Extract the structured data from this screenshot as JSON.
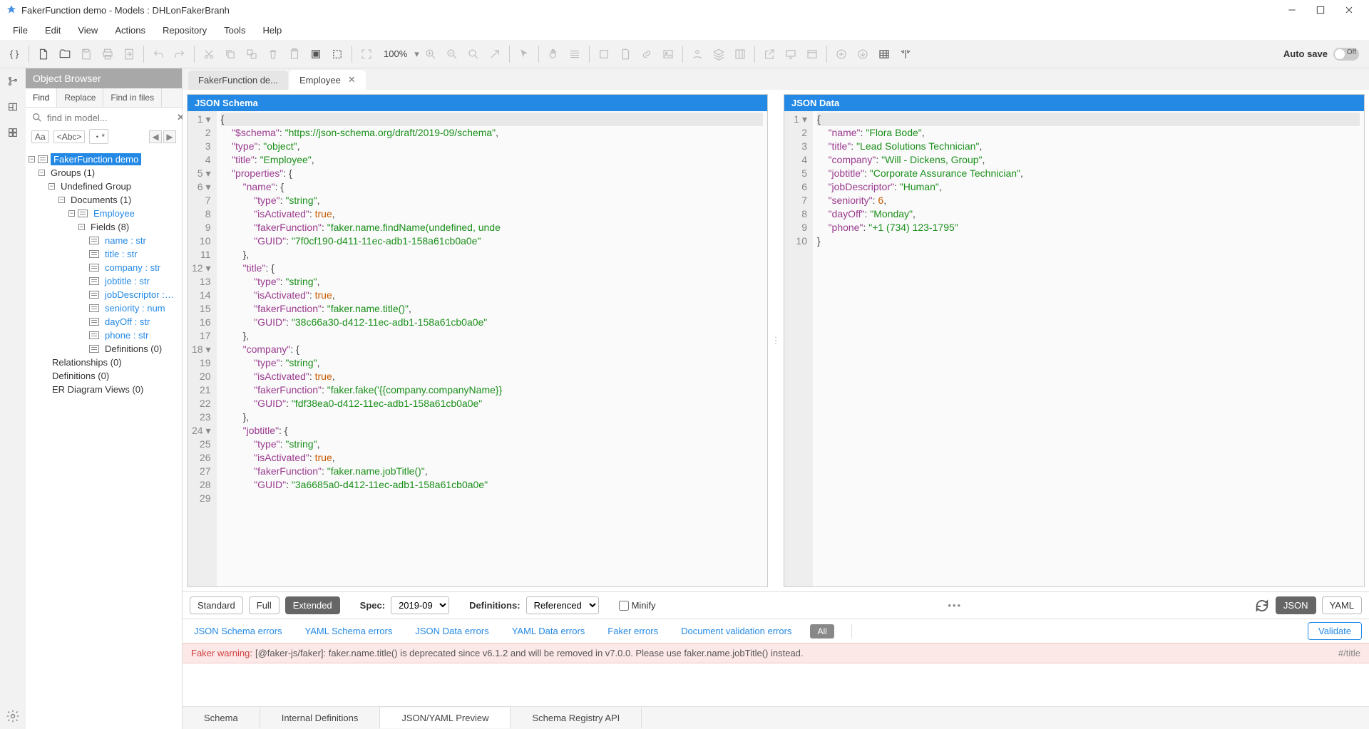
{
  "window": {
    "title": "FakerFunction demo - Models : DHLonFakerBranh"
  },
  "menu": [
    "File",
    "Edit",
    "View",
    "Actions",
    "Repository",
    "Tools",
    "Help"
  ],
  "toolbar": {
    "zoom": "100%",
    "autosave_label": "Auto save",
    "autosave_state": "Off"
  },
  "browser": {
    "title": "Object Browser",
    "tabs": [
      "Find",
      "Replace",
      "Find in files"
    ],
    "search_placeholder": "find in model...",
    "match_opts": [
      "Aa",
      "<Abc>",
      "・*"
    ]
  },
  "tree": {
    "root": "FakerFunction demo",
    "groups": "Groups (1)",
    "undef": "Undefined Group",
    "docs": "Documents (1)",
    "employee": "Employee",
    "fields_lbl": "Fields (8)",
    "fields": [
      "name : str",
      "title : str",
      "company : str",
      "jobtitle : str",
      "jobDescriptor : str",
      "seniority : num",
      "dayOff : str",
      "phone : str"
    ],
    "defs": "Definitions (0)",
    "rels": "Relationships (0)",
    "defs2": "Definitions (0)",
    "er": "ER Diagram Views (0)"
  },
  "tabs": [
    {
      "label": "FakerFunction de...",
      "closable": false
    },
    {
      "label": "Employee",
      "closable": true
    }
  ],
  "panes": {
    "left": "JSON Schema",
    "right": "JSON Data"
  },
  "schema_gutter": [
    "1 ▾",
    "2",
    "3",
    "4",
    "5 ▾",
    "6 ▾",
    "7",
    "8",
    "9",
    "10",
    "11",
    "12 ▾",
    "13",
    "14",
    "15",
    "16",
    "17",
    "18 ▾",
    "19",
    "20",
    "21",
    "22",
    "23",
    "24 ▾",
    "25",
    "26",
    "27",
    "28",
    "29"
  ],
  "schema_lines": [
    [
      [
        "p",
        "{"
      ]
    ],
    [
      [
        "p",
        "    "
      ],
      [
        "k",
        "\"$schema\""
      ],
      [
        "p",
        ": "
      ],
      [
        "s",
        "\"https://json-schema.org/draft/2019-09/schema\""
      ],
      [
        "p",
        ","
      ]
    ],
    [
      [
        "p",
        "    "
      ],
      [
        "k",
        "\"type\""
      ],
      [
        "p",
        ": "
      ],
      [
        "s",
        "\"object\""
      ],
      [
        "p",
        ","
      ]
    ],
    [
      [
        "p",
        "    "
      ],
      [
        "k",
        "\"title\""
      ],
      [
        "p",
        ": "
      ],
      [
        "s",
        "\"Employee\""
      ],
      [
        "p",
        ","
      ]
    ],
    [
      [
        "p",
        "    "
      ],
      [
        "k",
        "\"properties\""
      ],
      [
        "p",
        ": {"
      ]
    ],
    [
      [
        "p",
        "        "
      ],
      [
        "k",
        "\"name\""
      ],
      [
        "p",
        ": {"
      ]
    ],
    [
      [
        "p",
        "            "
      ],
      [
        "k",
        "\"type\""
      ],
      [
        "p",
        ": "
      ],
      [
        "s",
        "\"string\""
      ],
      [
        "p",
        ","
      ]
    ],
    [
      [
        "p",
        "            "
      ],
      [
        "k",
        "\"isActivated\""
      ],
      [
        "p",
        ": "
      ],
      [
        "b",
        "true"
      ],
      [
        "p",
        ","
      ]
    ],
    [
      [
        "p",
        "            "
      ],
      [
        "k",
        "\"fakerFunction\""
      ],
      [
        "p",
        ": "
      ],
      [
        "s",
        "\"faker.name.findName(undefined, unde"
      ]
    ],
    [
      [
        "p",
        "            "
      ],
      [
        "k",
        "\"GUID\""
      ],
      [
        "p",
        ": "
      ],
      [
        "s",
        "\"7f0cf190-d411-11ec-adb1-158a61cb0a0e\""
      ]
    ],
    [
      [
        "p",
        "        },"
      ]
    ],
    [
      [
        "p",
        "        "
      ],
      [
        "k",
        "\"title\""
      ],
      [
        "p",
        ": {"
      ]
    ],
    [
      [
        "p",
        "            "
      ],
      [
        "k",
        "\"type\""
      ],
      [
        "p",
        ": "
      ],
      [
        "s",
        "\"string\""
      ],
      [
        "p",
        ","
      ]
    ],
    [
      [
        "p",
        "            "
      ],
      [
        "k",
        "\"isActivated\""
      ],
      [
        "p",
        ": "
      ],
      [
        "b",
        "true"
      ],
      [
        "p",
        ","
      ]
    ],
    [
      [
        "p",
        "            "
      ],
      [
        "k",
        "\"fakerFunction\""
      ],
      [
        "p",
        ": "
      ],
      [
        "s",
        "\"faker.name.title()\""
      ],
      [
        "p",
        ","
      ]
    ],
    [
      [
        "p",
        "            "
      ],
      [
        "k",
        "\"GUID\""
      ],
      [
        "p",
        ": "
      ],
      [
        "s",
        "\"38c66a30-d412-11ec-adb1-158a61cb0a0e\""
      ]
    ],
    [
      [
        "p",
        "        },"
      ]
    ],
    [
      [
        "p",
        "        "
      ],
      [
        "k",
        "\"company\""
      ],
      [
        "p",
        ": {"
      ]
    ],
    [
      [
        "p",
        "            "
      ],
      [
        "k",
        "\"type\""
      ],
      [
        "p",
        ": "
      ],
      [
        "s",
        "\"string\""
      ],
      [
        "p",
        ","
      ]
    ],
    [
      [
        "p",
        "            "
      ],
      [
        "k",
        "\"isActivated\""
      ],
      [
        "p",
        ": "
      ],
      [
        "b",
        "true"
      ],
      [
        "p",
        ","
      ]
    ],
    [
      [
        "p",
        "            "
      ],
      [
        "k",
        "\"fakerFunction\""
      ],
      [
        "p",
        ": "
      ],
      [
        "s",
        "\"faker.fake('{{company.companyName}}"
      ]
    ],
    [
      [
        "p",
        "            "
      ],
      [
        "k",
        "\"GUID\""
      ],
      [
        "p",
        ": "
      ],
      [
        "s",
        "\"fdf38ea0-d412-11ec-adb1-158a61cb0a0e\""
      ]
    ],
    [
      [
        "p",
        "        },"
      ]
    ],
    [
      [
        "p",
        "        "
      ],
      [
        "k",
        "\"jobtitle\""
      ],
      [
        "p",
        ": {"
      ]
    ],
    [
      [
        "p",
        "            "
      ],
      [
        "k",
        "\"type\""
      ],
      [
        "p",
        ": "
      ],
      [
        "s",
        "\"string\""
      ],
      [
        "p",
        ","
      ]
    ],
    [
      [
        "p",
        "            "
      ],
      [
        "k",
        "\"isActivated\""
      ],
      [
        "p",
        ": "
      ],
      [
        "b",
        "true"
      ],
      [
        "p",
        ","
      ]
    ],
    [
      [
        "p",
        "            "
      ],
      [
        "k",
        "\"fakerFunction\""
      ],
      [
        "p",
        ": "
      ],
      [
        "s",
        "\"faker.name.jobTitle()\""
      ],
      [
        "p",
        ","
      ]
    ],
    [
      [
        "p",
        "            "
      ],
      [
        "k",
        "\"GUID\""
      ],
      [
        "p",
        ": "
      ],
      [
        "s",
        "\"3a6685a0-d412-11ec-adb1-158a61cb0a0e\""
      ]
    ],
    [
      [
        "p",
        ""
      ]
    ]
  ],
  "data_gutter": [
    "1 ▾",
    "2",
    "3",
    "4",
    "5",
    "6",
    "7",
    "8",
    "9",
    "10"
  ],
  "data_lines": [
    [
      [
        "p",
        "{"
      ]
    ],
    [
      [
        "p",
        "    "
      ],
      [
        "k",
        "\"name\""
      ],
      [
        "p",
        ": "
      ],
      [
        "s",
        "\"Flora Bode\""
      ],
      [
        "p",
        ","
      ]
    ],
    [
      [
        "p",
        "    "
      ],
      [
        "k",
        "\"title\""
      ],
      [
        "p",
        ": "
      ],
      [
        "s",
        "\"Lead Solutions Technician\""
      ],
      [
        "p",
        ","
      ]
    ],
    [
      [
        "p",
        "    "
      ],
      [
        "k",
        "\"company\""
      ],
      [
        "p",
        ": "
      ],
      [
        "s",
        "\"Will - Dickens, Group\""
      ],
      [
        "p",
        ","
      ]
    ],
    [
      [
        "p",
        "    "
      ],
      [
        "k",
        "\"jobtitle\""
      ],
      [
        "p",
        ": "
      ],
      [
        "s",
        "\"Corporate Assurance Technician\""
      ],
      [
        "p",
        ","
      ]
    ],
    [
      [
        "p",
        "    "
      ],
      [
        "k",
        "\"jobDescriptor\""
      ],
      [
        "p",
        ": "
      ],
      [
        "s",
        "\"Human\""
      ],
      [
        "p",
        ","
      ]
    ],
    [
      [
        "p",
        "    "
      ],
      [
        "k",
        "\"seniority\""
      ],
      [
        "p",
        ": "
      ],
      [
        "b",
        "6"
      ],
      [
        "p",
        ","
      ]
    ],
    [
      [
        "p",
        "    "
      ],
      [
        "k",
        "\"dayOff\""
      ],
      [
        "p",
        ": "
      ],
      [
        "s",
        "\"Monday\""
      ],
      [
        "p",
        ","
      ]
    ],
    [
      [
        "p",
        "    "
      ],
      [
        "k",
        "\"phone\""
      ],
      [
        "p",
        ": "
      ],
      [
        "s",
        "\"+1 (734) 123-1795\""
      ]
    ],
    [
      [
        "p",
        "}"
      ]
    ]
  ],
  "ctrl": {
    "modes": [
      "Standard",
      "Full",
      "Extended"
    ],
    "spec_label": "Spec:",
    "spec_value": "2019-09",
    "def_label": "Definitions:",
    "def_value": "Referenced",
    "minify": "Minify",
    "json": "JSON",
    "yaml": "YAML"
  },
  "errtabs": [
    "JSON Schema errors",
    "YAML Schema errors",
    "JSON Data errors",
    "YAML Data errors",
    "Faker errors",
    "Document validation errors"
  ],
  "err_all": "All",
  "validate": "Validate",
  "warning": {
    "label": "Faker warning:",
    "text": "[@faker-js/faker]: faker.name.title() is deprecated since v6.1.2 and will be removed in v7.0.0. Please use faker.name.jobTitle() instead.",
    "loc": "#/title"
  },
  "bottom_tabs": [
    "Schema",
    "Internal Definitions",
    "JSON/YAML Preview",
    "Schema Registry API"
  ]
}
